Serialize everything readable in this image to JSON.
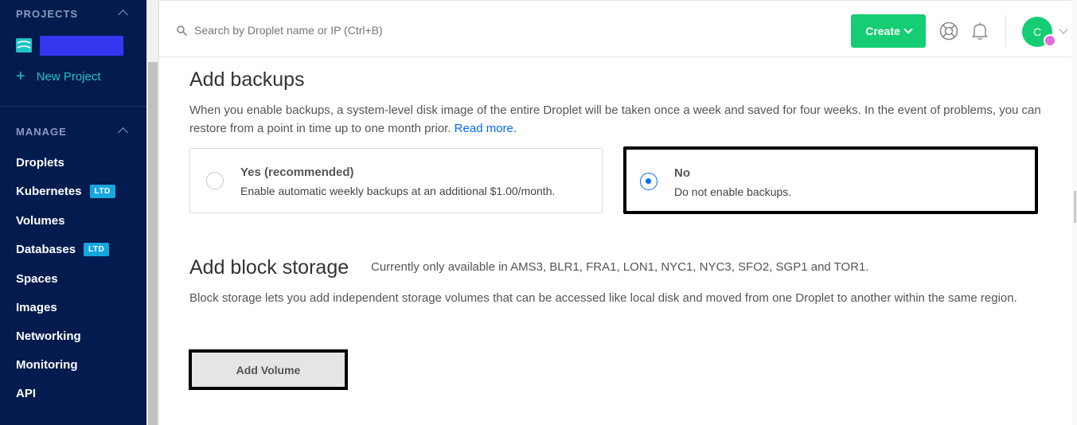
{
  "sidebar": {
    "projects_title": "PROJECTS",
    "new_project_label": "New Project",
    "manage_title": "MANAGE",
    "items": [
      {
        "label": "Droplets",
        "badge": ""
      },
      {
        "label": "Kubernetes",
        "badge": "LTD"
      },
      {
        "label": "Volumes",
        "badge": ""
      },
      {
        "label": "Databases",
        "badge": "LTD"
      },
      {
        "label": "Spaces",
        "badge": ""
      },
      {
        "label": "Images",
        "badge": ""
      },
      {
        "label": "Networking",
        "badge": ""
      },
      {
        "label": "Monitoring",
        "badge": ""
      },
      {
        "label": "API",
        "badge": ""
      }
    ]
  },
  "topbar": {
    "search_placeholder": "Search by Droplet name or IP (Ctrl+B)",
    "create_label": "Create",
    "avatar_initial": "C"
  },
  "backups": {
    "title": "Add backups",
    "description": "When you enable backups, a system-level disk image of the entire Droplet will be taken once a week and saved for four weeks. In the event of problems, you can restore from a point in time up to one month prior.",
    "read_more": "Read more.",
    "options": [
      {
        "title": "Yes (recommended)",
        "desc": "Enable automatic weekly backups at an additional $1.00/month.",
        "selected": false
      },
      {
        "title": "No",
        "desc": "Do not enable backups.",
        "selected": true
      }
    ]
  },
  "block_storage": {
    "title": "Add block storage",
    "availability": "Currently only available in AMS3, BLR1, FRA1, LON1, NYC1, NYC3, SFO2, SGP1 and TOR1.",
    "description": "Block storage lets you add independent storage volumes that can be accessed like local disk and moved from one Droplet to another within the same region.",
    "add_volume_label": "Add Volume"
  },
  "colors": {
    "sidebar_bg": "#031b4e",
    "accent_teal": "#1fc4c8",
    "create_green": "#15cd72",
    "link_blue": "#0069ff",
    "badge_blue": "#15a7de"
  }
}
